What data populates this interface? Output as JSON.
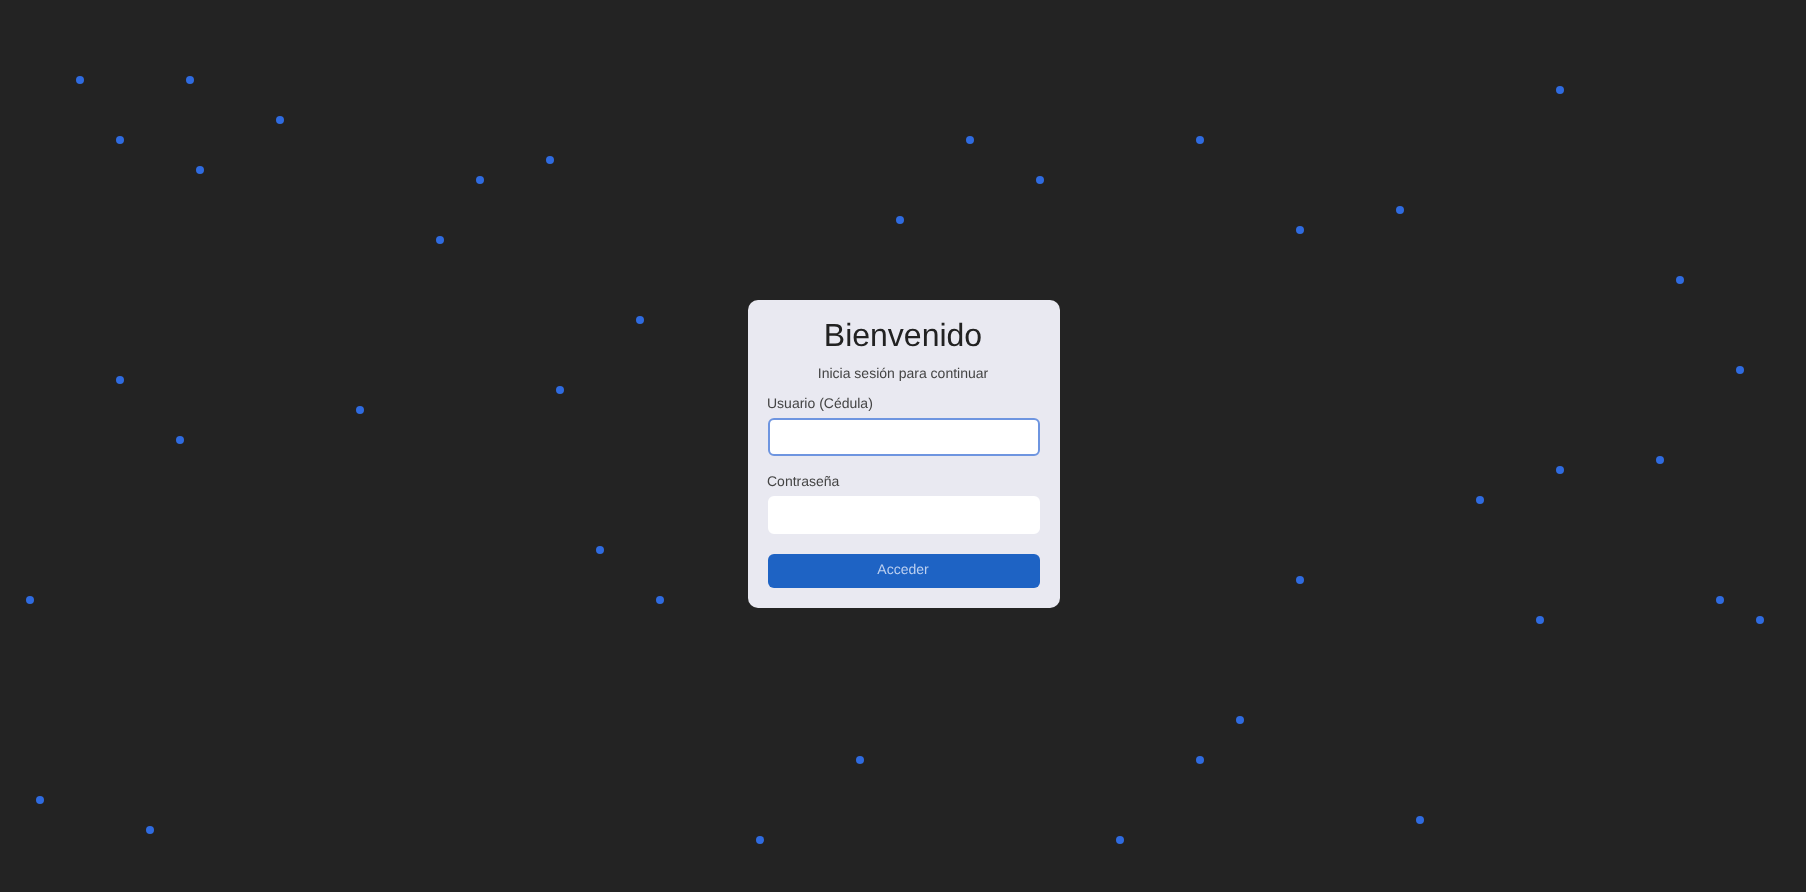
{
  "login": {
    "title": "Bienvenido",
    "subtitle": "Inicia sesión para continuar",
    "fields": [
      {
        "label": "Usuario (Cédula)",
        "focused": true
      },
      {
        "label": "Contraseña",
        "focused": false
      }
    ],
    "button": "Acceder"
  }
}
